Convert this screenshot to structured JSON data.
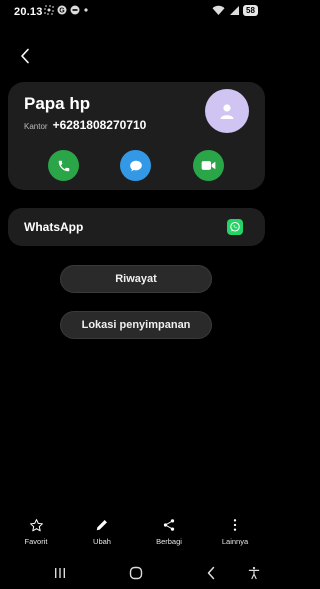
{
  "status_bar": {
    "time": "20.13",
    "battery": "58"
  },
  "contact": {
    "name": "Papa hp",
    "phone_label": "Kantor",
    "phone_number": "+6281808270710"
  },
  "whatsapp": {
    "label": "WhatsApp"
  },
  "buttons": {
    "history": "Riwayat",
    "storage": "Lokasi penyimpanan"
  },
  "bottom_actions": {
    "favorite": "Favorit",
    "edit": "Ubah",
    "share": "Berbagi",
    "more": "Lainnya"
  },
  "colors": {
    "call": "#2aa548",
    "message": "#3399e6",
    "video": "#2aa548",
    "avatar": "#cfc4f2",
    "whatsapp": "#25d366"
  }
}
